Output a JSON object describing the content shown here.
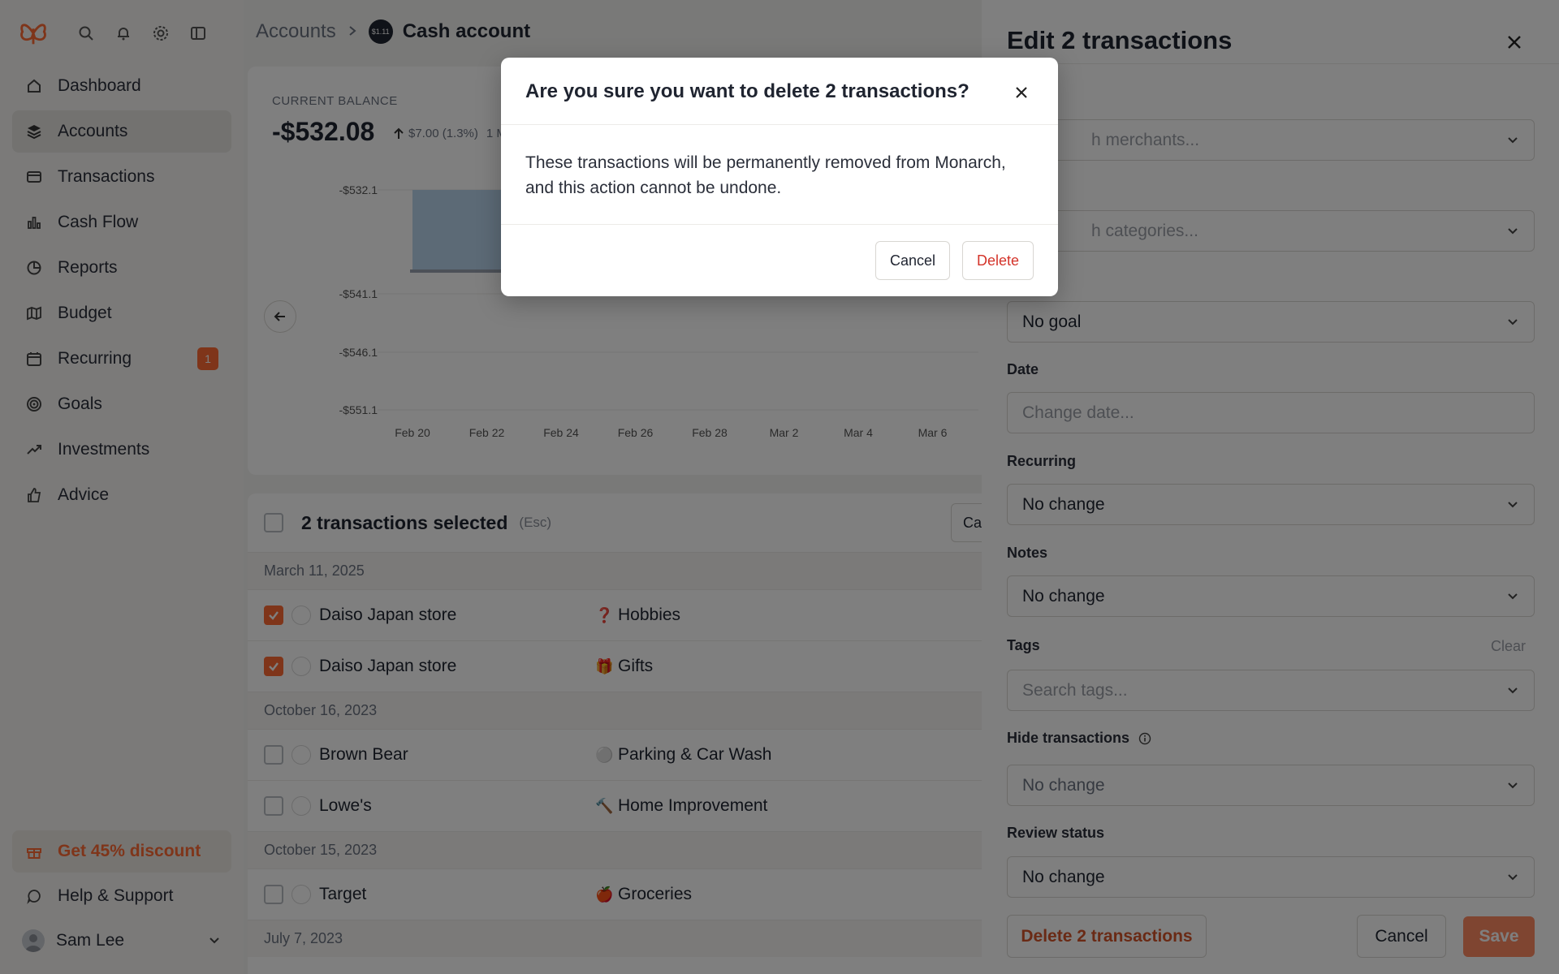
{
  "sidebar": {
    "nav": [
      {
        "label": "Dashboard",
        "icon": "home-icon"
      },
      {
        "label": "Accounts",
        "icon": "layers-icon",
        "active": true
      },
      {
        "label": "Transactions",
        "icon": "credit-card-icon"
      },
      {
        "label": "Cash Flow",
        "icon": "bar-chart-icon"
      },
      {
        "label": "Reports",
        "icon": "pie-chart-icon"
      },
      {
        "label": "Budget",
        "icon": "map-icon"
      },
      {
        "label": "Recurring",
        "icon": "calendar-icon",
        "badge": "1"
      },
      {
        "label": "Goals",
        "icon": "target-icon"
      },
      {
        "label": "Investments",
        "icon": "trending-up-icon"
      },
      {
        "label": "Advice",
        "icon": "thumbs-up-icon"
      }
    ],
    "promo": "Get 45% discount",
    "help": "Help & Support",
    "user": "Sam Lee"
  },
  "breadcrumb": {
    "parent": "Accounts",
    "current": "Cash account",
    "account_icon_text": "$1.11"
  },
  "balance": {
    "label": "CURRENT BALANCE",
    "value": "-$532.08",
    "change": "$7.00 (1.3%)",
    "period": "1 M"
  },
  "chart_data": {
    "type": "area",
    "x": [
      "Feb 20",
      "Feb 22",
      "Feb 24",
      "Feb 26",
      "Feb 28",
      "Mar 2",
      "Mar 4",
      "Mar 6"
    ],
    "y_ticks": [
      "-$532.1",
      "-$541.1",
      "-$546.1",
      "-$551.1"
    ],
    "series": [
      {
        "values": [
          -532.1,
          -532.1
        ]
      }
    ]
  },
  "transactions": {
    "title": "2 transactions selected",
    "esc": "(Esc)",
    "header_button": "Ca",
    "groups": [
      {
        "date": "March 11, 2025",
        "rows": [
          {
            "merchant": "Daiso Japan store",
            "category_emoji": "❓",
            "category": "Hobbies",
            "checked": true
          },
          {
            "merchant": "Daiso Japan store",
            "category_emoji": "🎁",
            "category": "Gifts",
            "checked": true
          }
        ]
      },
      {
        "date": "October 16, 2023",
        "rows": [
          {
            "merchant": "Brown Bear",
            "category_emoji": "⚪",
            "category": "Parking & Car Wash",
            "checked": false
          },
          {
            "merchant": "Lowe's",
            "category_emoji": "🔨",
            "category": "Home Improvement",
            "checked": false
          }
        ]
      },
      {
        "date": "October 15, 2023",
        "rows": [
          {
            "merchant": "Target",
            "category_emoji": "🍎",
            "category": "Groceries",
            "checked": false
          }
        ]
      },
      {
        "date": "July 7, 2023",
        "rows": []
      }
    ]
  },
  "drawer": {
    "title": "Edit 2 transactions",
    "fields": {
      "merchant_label": "nt",
      "merchant_placeholder": "h merchants...",
      "category_label": "ry",
      "category_placeholder": "h categories...",
      "goal_value": "No goal",
      "date_label": "Date",
      "date_placeholder": "Change date...",
      "recurring_label": "Recurring",
      "recurring_value": "No change",
      "notes_label": "Notes",
      "notes_value": "No change",
      "tags_label": "Tags",
      "tags_clear": "Clear",
      "tags_placeholder": "Search tags...",
      "hide_label": "Hide transactions",
      "hide_value": "No change",
      "review_label": "Review status",
      "review_value": "No change"
    },
    "delete_button": "Delete 2 transactions",
    "cancel_button": "Cancel",
    "save_button": "Save"
  },
  "modal": {
    "title": "Are you sure you want to delete 2 transactions?",
    "body": "These transactions will be permanently removed from Monarch, and this action cannot be undone.",
    "cancel": "Cancel",
    "delete": "Delete"
  }
}
